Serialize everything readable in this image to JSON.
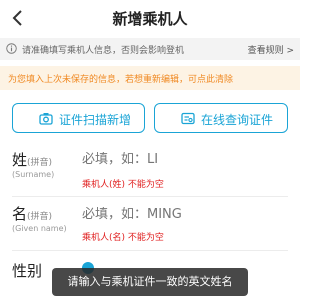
{
  "header": {
    "title": "新增乘机人",
    "back_icon": "chevron-left-icon"
  },
  "notice": {
    "text": "请准确填写乘机人信息，否则会影响登机",
    "rules_link": "查看规则 >",
    "icon": "info-icon"
  },
  "warning": {
    "text": "为您填入上次未保存的信息，若想重新编辑，可点此清除",
    "color": "#f08a24"
  },
  "actions": {
    "scan": {
      "label": "证件扫描新增",
      "icon": "camera-icon"
    },
    "query": {
      "label": "在线查询证件",
      "icon": "id-card-icon"
    },
    "accent": "#1aa4d6"
  },
  "form": {
    "surname": {
      "label": "姓",
      "label_sub": "(拼音)",
      "label_en": "(Surname)",
      "placeholder": "必填，如：LI",
      "error": "乘机人(姓) 不能为空"
    },
    "given": {
      "label": "名",
      "label_sub": "(拼音)",
      "label_en": "(Given name)",
      "placeholder": "必填，如：MING",
      "error": "乘机人(名) 不能为空"
    },
    "gender": {
      "label": "性别"
    },
    "error_color": "#e02020"
  },
  "toast": {
    "text": "请输入与乘机证件一致的英文姓名"
  }
}
